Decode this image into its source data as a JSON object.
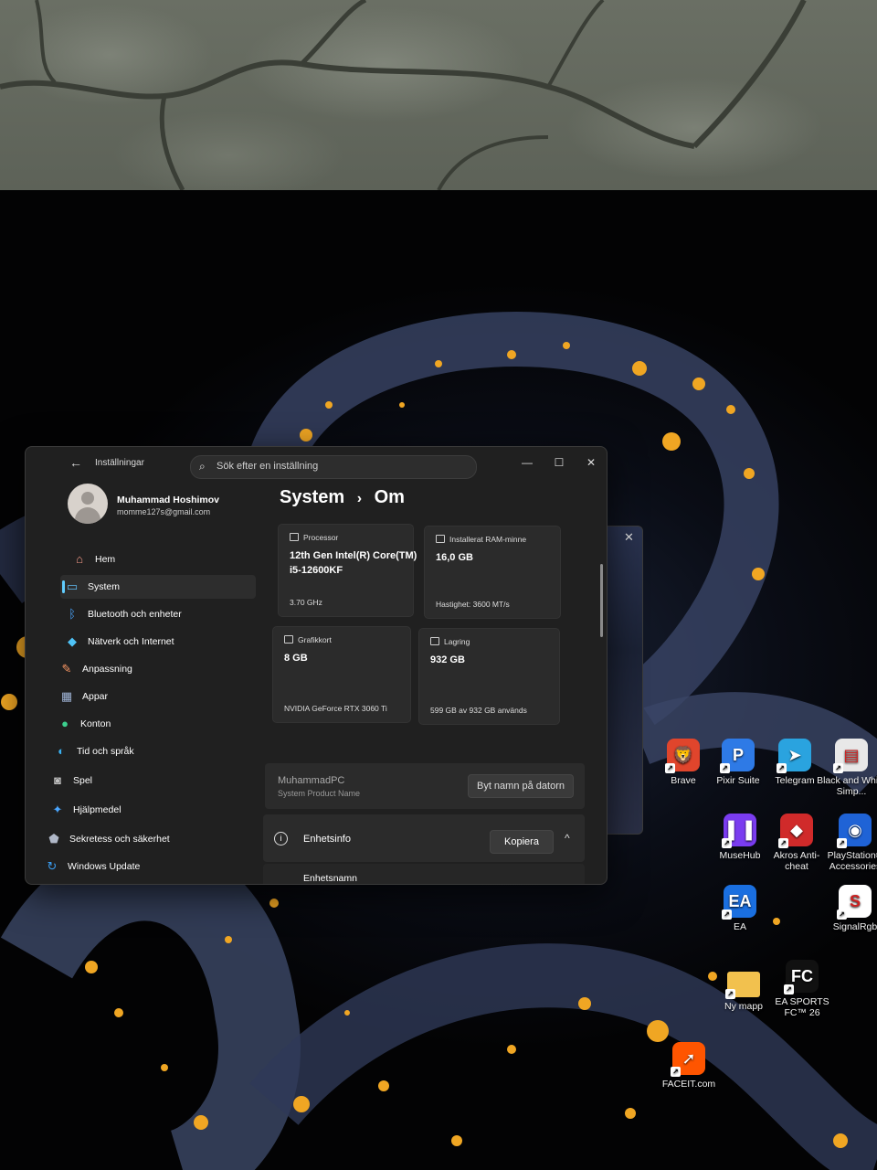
{
  "settings": {
    "app_title": "Inställningar",
    "search_placeholder": "Sök efter en inställning",
    "window_controls": {
      "minimize": "—",
      "maximize": "☐",
      "close": "✕"
    },
    "user": {
      "name": "Muhammad Hoshimov",
      "email": "momme127s@gmail.com"
    },
    "nav": [
      {
        "label": "Hem",
        "icon": "home-icon"
      },
      {
        "label": "System",
        "icon": "monitor-icon",
        "selected": true
      },
      {
        "label": "Bluetooth och enheter",
        "icon": "bluetooth-icon"
      },
      {
        "label": "Nätverk och Internet",
        "icon": "wifi-icon"
      },
      {
        "label": "Anpassning",
        "icon": "brush-icon"
      },
      {
        "label": "Appar",
        "icon": "apps-icon"
      },
      {
        "label": "Konton",
        "icon": "person-icon"
      },
      {
        "label": "Tid och språk",
        "icon": "globe-clock-icon"
      },
      {
        "label": "Spel",
        "icon": "gamepad-icon"
      },
      {
        "label": "Hjälpmedel",
        "icon": "accessibility-icon"
      },
      {
        "label": "Sekretess och säkerhet",
        "icon": "shield-icon"
      },
      {
        "label": "Windows Update",
        "icon": "update-icon"
      }
    ],
    "breadcrumb": {
      "parent": "System",
      "separator": "›",
      "current": "Om"
    },
    "specs": {
      "processor": {
        "label": "Processor",
        "value": "12th Gen Intel(R) Core(TM) i5-12600KF",
        "sub": "3.70 GHz"
      },
      "ram": {
        "label": "Installerat RAM-minne",
        "value": "16,0 GB",
        "sub": "Hastighet: 3600 MT/s"
      },
      "gpu": {
        "label": "Grafikkort",
        "value": "8 GB",
        "sub": "NVIDIA GeForce RTX 3060 Ti"
      },
      "storage": {
        "label": "Lagring",
        "value": "932 GB",
        "sub": "599 GB av 932 GB används"
      }
    },
    "device": {
      "name": "MuhammadPC",
      "sub": "System Product Name",
      "rename_button": "Byt namn på datorn"
    },
    "device_info": {
      "label": "Enhetsinfo",
      "copy_button": "Kopiera",
      "chevron": "^",
      "next_label": "Enhetsnamn"
    }
  },
  "desktop_icons": [
    {
      "label": "Brave",
      "icon": "brave-icon",
      "color": "#e0452c"
    },
    {
      "label": "Pixir Suite",
      "icon": "pixir-icon",
      "color": "#2e7ae6"
    },
    {
      "label": "Telegram",
      "icon": "telegram-icon",
      "color": "#2aa3df"
    },
    {
      "label": "Black and White Simp...",
      "icon": "pdf-icon",
      "color": "#e8e8e8"
    },
    {
      "label": "MuseHub",
      "icon": "musehub-icon",
      "color": "#7a3cf0"
    },
    {
      "label": "Akros Anti-cheat",
      "icon": "akros-icon",
      "color": "#d02a2a"
    },
    {
      "label": "PlayStation® Accessories",
      "icon": "playstation-icon",
      "color": "#1f63d6"
    },
    {
      "label": "EA",
      "icon": "ea-icon",
      "color": "#1a6fe0"
    },
    {
      "label": "SignalRgb",
      "icon": "signalrgb-icon",
      "color": "#ffffff"
    },
    {
      "label": "Ny mapp",
      "icon": "folder-icon",
      "color": "#f2c14e"
    },
    {
      "label": "EA SPORTS FC™ 26",
      "icon": "easportsfc-icon",
      "color": "#111111"
    },
    {
      "label": "FACEIT.com",
      "icon": "faceit-icon",
      "color": "#ff5500"
    }
  ]
}
